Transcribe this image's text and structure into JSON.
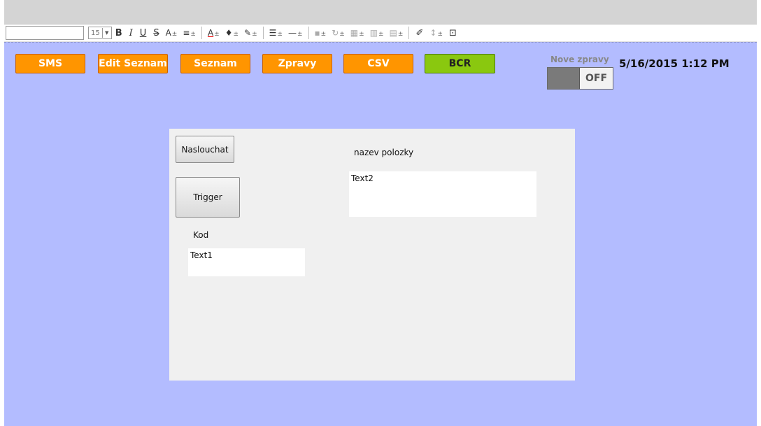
{
  "toolbar": {
    "font_size": "15",
    "bold": "B",
    "italic": "I",
    "underline": "U",
    "strike": "S",
    "font_grow": "A",
    "align": "≡",
    "font_color": "A",
    "fill": "♦",
    "pen": "✎",
    "line_style": "☰",
    "line_width": "—",
    "shadow": "▪",
    "rotate": "↻",
    "arrange": "▦",
    "distribute": "▥",
    "spacing": "▤",
    "brush": "✐",
    "format": "↕",
    "zoom": "⊡"
  },
  "nav_buttons": [
    {
      "label": "SMS"
    },
    {
      "label": "Edit Seznam"
    },
    {
      "label": "Seznam"
    },
    {
      "label": "Zpravy"
    },
    {
      "label": "CSV"
    },
    {
      "label": "BCR"
    }
  ],
  "colors": {
    "canvas": "#b3bcff",
    "orange_button": "#ff9500",
    "green_button": "#8ac80f",
    "panel": "#f0f0f0"
  },
  "toggle": {
    "label": "Nove zpravy",
    "state": "OFF"
  },
  "datetime": "5/16/2015 1:12 PM",
  "form": {
    "listen_button": "Naslouchat",
    "trigger_button": "Trigger",
    "code_label": "Kod",
    "text1": "Text1",
    "item_label": "nazev polozky",
    "text2": "Text2"
  }
}
